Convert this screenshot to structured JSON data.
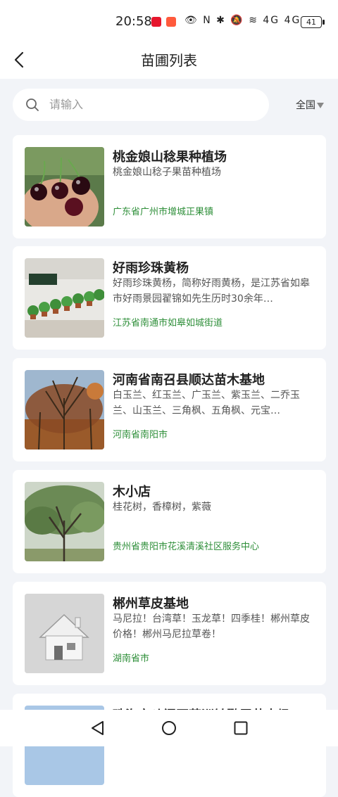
{
  "status_bar": {
    "time": "20:58",
    "icons": "👁 N ✱ 🔕 ≋ 4G 4G",
    "battery": "41"
  },
  "header": {
    "title": "苗圃列表"
  },
  "search": {
    "placeholder": "请输入",
    "region": "全国"
  },
  "nurseries": [
    {
      "name": "桃金娘山稔果种植场",
      "desc": "桃金娘山稔子果苗种植场",
      "location": "广东省广州市增城正果镇"
    },
    {
      "name": "好雨珍珠黄杨",
      "desc": "好雨珍珠黄杨，简称好雨黄杨，是江苏省如皋市好雨景园翟锦如先生历时30余年…",
      "location": "江苏省南通市如皋如城街道"
    },
    {
      "name": "河南省南召县顺达苗木基地",
      "desc": "白玉兰、红玉兰、广玉兰、紫玉兰、二乔玉兰、山玉兰、三角枫、五角枫、元宝…",
      "location": "河南省南阳市"
    },
    {
      "name": "木小店",
      "desc": "桂花树，香樟树，紫薇",
      "location": "贵州省贵阳市花溪清溪社区服务中心"
    },
    {
      "name": "郴州草皮基地",
      "desc": "马尼拉！台湾草！玉龙草！四季桂！郴州草皮价格！郴州马尼拉草卷！",
      "location": "湖南省市"
    },
    {
      "name": "珠海市斗门区莲洲镇鹏展苗木场",
      "desc": "",
      "location": ""
    }
  ],
  "colors": {
    "location_green": "#2f8f3a",
    "background": "#f2f4f8"
  }
}
